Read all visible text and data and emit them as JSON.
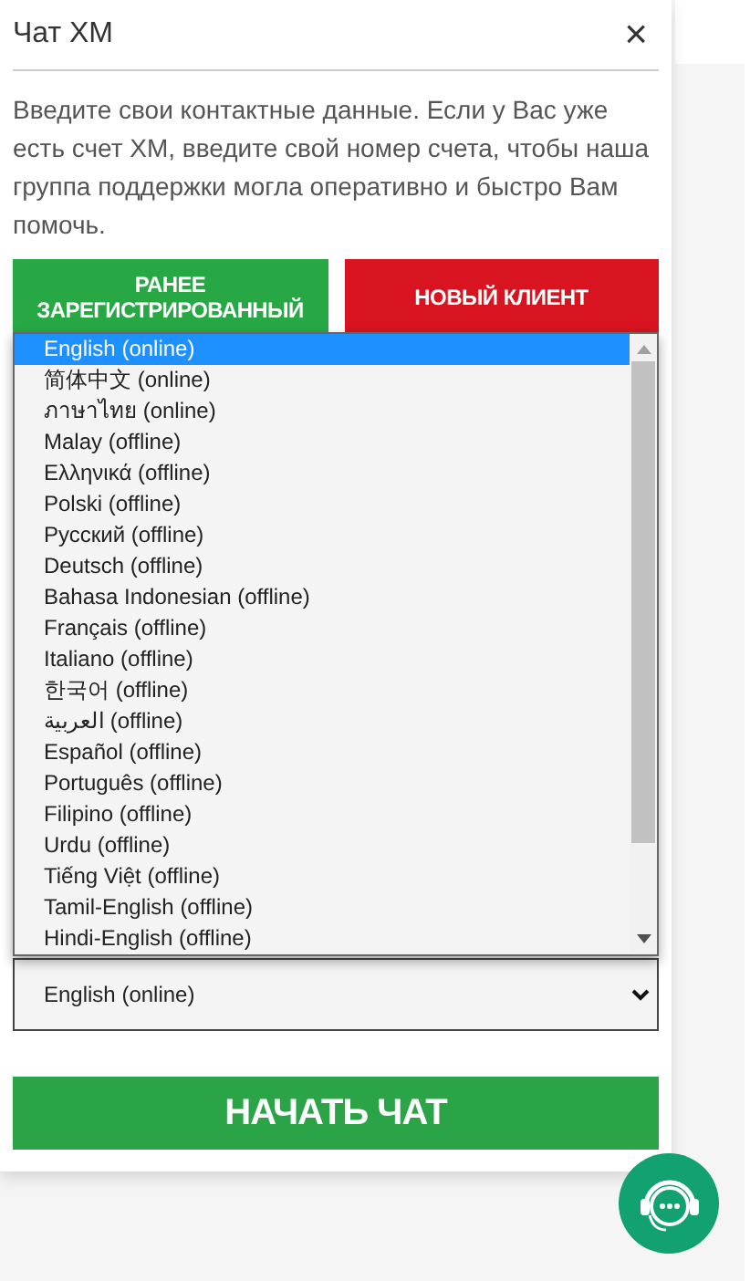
{
  "header": {
    "title": "Чат XM",
    "close": "×"
  },
  "intro": "Введите свои контактные данные. Если у Вас уже есть счет XM, введите свой номер счета, чтобы наша группа поддержки могла оперативно и быстро Вам помочь.",
  "client_tabs": [
    {
      "label": "РАНЕЕ ЗАРЕГИСТРИРОВАННЫЙ",
      "color": "#28a745"
    },
    {
      "label": "НОВЫЙ КЛИЕНТ",
      "color": "#d7141f"
    }
  ],
  "language_options": [
    {
      "label": "English (online)",
      "selected": true
    },
    {
      "label": "简体中文 (online)",
      "selected": false
    },
    {
      "label": "ภาษาไทย (online)",
      "selected": false
    },
    {
      "label": "Malay (offline)",
      "selected": false
    },
    {
      "label": "Ελληνικά (offline)",
      "selected": false
    },
    {
      "label": "Polski (offline)",
      "selected": false
    },
    {
      "label": "Русский (offline)",
      "selected": false
    },
    {
      "label": "Deutsch (offline)",
      "selected": false
    },
    {
      "label": "Bahasa Indonesian (offline)",
      "selected": false
    },
    {
      "label": "Français (offline)",
      "selected": false
    },
    {
      "label": "Italiano (offline)",
      "selected": false
    },
    {
      "label": "한국어 (offline)",
      "selected": false
    },
    {
      "label": "العربية (offline)",
      "selected": false
    },
    {
      "label": "Español (offline)",
      "selected": false
    },
    {
      "label": "Português (offline)",
      "selected": false
    },
    {
      "label": "Filipino (offline)",
      "selected": false
    },
    {
      "label": "Urdu (offline)",
      "selected": false
    },
    {
      "label": "Tiếng Việt (offline)",
      "selected": false
    },
    {
      "label": "Tamil-English (offline)",
      "selected": false
    },
    {
      "label": "Hindi-English (offline)",
      "selected": false
    }
  ],
  "language_select": {
    "value": "English (online)"
  },
  "start_button": "НАЧАТЬ ЧАТ"
}
